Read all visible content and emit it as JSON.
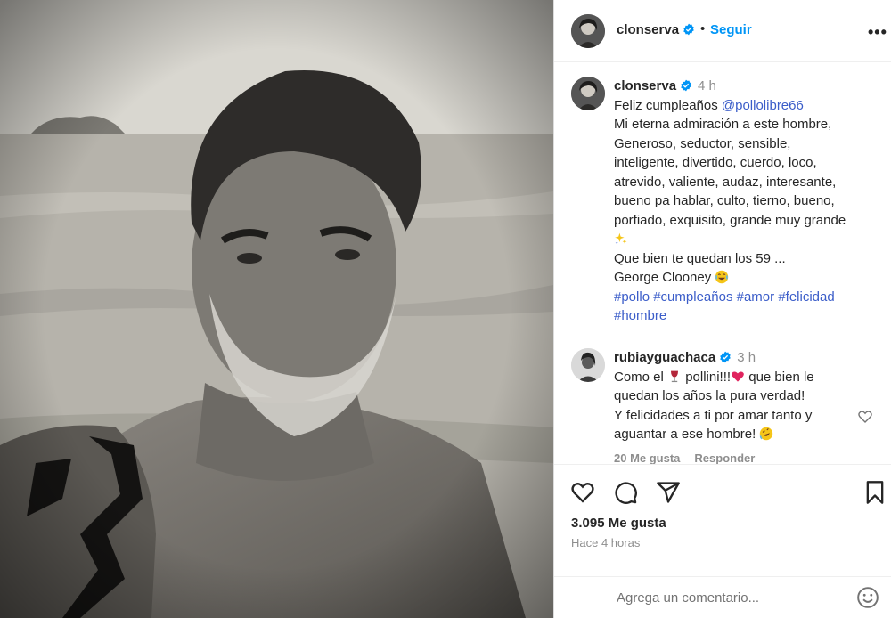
{
  "post": {
    "username": "clonserva",
    "follow_label": "Seguir",
    "dot": "•",
    "more_label": "•••",
    "caption": {
      "time": "4 h",
      "greeting": "Feliz cumpleaños",
      "mention": "@pollolibre66",
      "lines": [
        "Mi eterna admiración a este hombre,",
        "Generoso, seductor, sensible,",
        "inteligente, divertido, cuerdo, loco,",
        "atrevido, valiente, audaz, interesante,",
        "bueno pa hablar, culto, tierno, bueno,",
        "porfiado, exquisito, grande muy grande"
      ],
      "line_after_emoji_1": "Que bien te quedan los 59 ...",
      "line_after_emoji_2": "George Clooney",
      "hashtags": [
        "#pollo",
        "#cumpleaños",
        "#amor",
        "#felicidad",
        "#hombre"
      ]
    },
    "comment": {
      "username": "rubiayguachaca",
      "time": "3 h",
      "text_part1": "Como el",
      "text_part2": "pollini!!!",
      "text_part3": "que bien le",
      "line2": "quedan los años la pura verdad!",
      "line3": "Y felicidades a ti por amar tanto y",
      "line4": "aguantar a ese hombre!",
      "likes": "20 Me gusta",
      "reply": "Responder"
    },
    "likes": "3.095 Me gusta",
    "time_ago": "Hace 4 horas",
    "add_comment_placeholder": "Agrega un comentario..."
  },
  "colors": {
    "link_blue": "#0095f6",
    "hashtag": "#3b5dc9",
    "verified": "#0095f6",
    "muted": "#8e8e8e"
  }
}
